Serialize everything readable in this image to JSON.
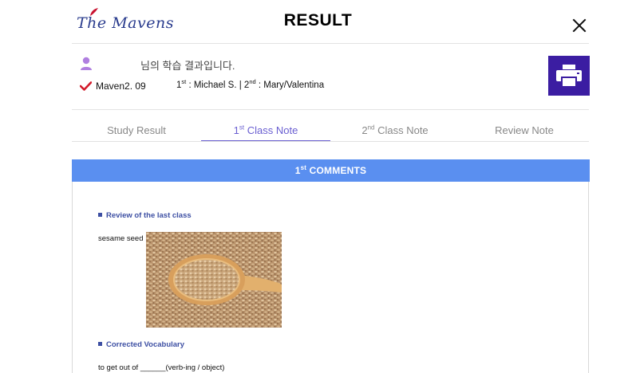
{
  "header": {
    "logo_text": "The Mavens",
    "title": "RESULT",
    "close_icon": "close-icon"
  },
  "user": {
    "avatar_icon": "user-avatar-icon",
    "message": "님의 학습 결과입니다."
  },
  "course": {
    "check_icon": "check-icon",
    "name": "Maven2. 09",
    "teacher1_ordinal": "1",
    "teacher1_suffix": "st",
    "teacher1_name": " : Michael S. | ",
    "teacher2_ordinal": "2",
    "teacher2_suffix": "nd",
    "teacher2_name": " : Mary/Valentina"
  },
  "print_button": {
    "icon": "printer-icon",
    "color": "#3b1da2"
  },
  "tabs": [
    {
      "label": "Study Result",
      "active": false
    },
    {
      "num": "1",
      "suffix": "st",
      "label": " Class Note",
      "active": true
    },
    {
      "num": "2",
      "suffix": "nd",
      "label": " Class Note",
      "active": false
    },
    {
      "label": "Review Note",
      "active": false
    }
  ],
  "accent_color": "#6a5fd1",
  "comments": {
    "header_num": "1",
    "header_suffix": "st",
    "header_label": " COMMENTS",
    "header_color": "#5a8ff0",
    "section1_title": "Review of the last class",
    "word": "sesame seed",
    "image_icon": "sesame-seed-image",
    "section2_title": "Corrected Vocabulary",
    "vocab_line": "to get out of ______(verb-ing / object)"
  }
}
